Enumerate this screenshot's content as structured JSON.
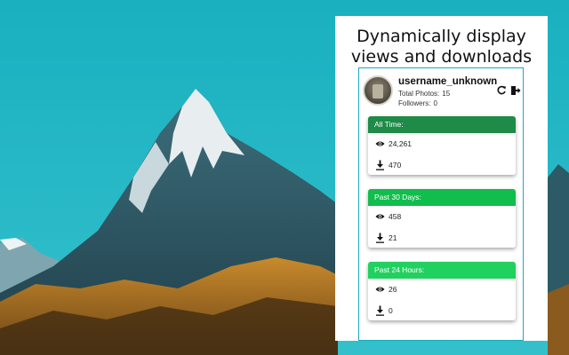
{
  "headline": {
    "line1": "Dynamically display",
    "line2": "views and downloads"
  },
  "profile": {
    "username": "username_unknown",
    "photos_label": "Total Photos:",
    "photos_value": "15",
    "followers_label": "Followers:",
    "followers_value": "0",
    "refresh_icon": "refresh-icon",
    "logout_icon": "logout-icon"
  },
  "cards": [
    {
      "title": "All Time:",
      "views": "24,261",
      "downloads": "470",
      "color": "#1e8b48"
    },
    {
      "title": "Past 30 Days:",
      "views": "458",
      "downloads": "21",
      "color": "#11bd4c"
    },
    {
      "title": "Past 24 Hours:",
      "views": "26",
      "downloads": "0",
      "color": "#21d160"
    }
  ],
  "icons": {
    "views": "eye-icon",
    "downloads": "download-icon"
  }
}
